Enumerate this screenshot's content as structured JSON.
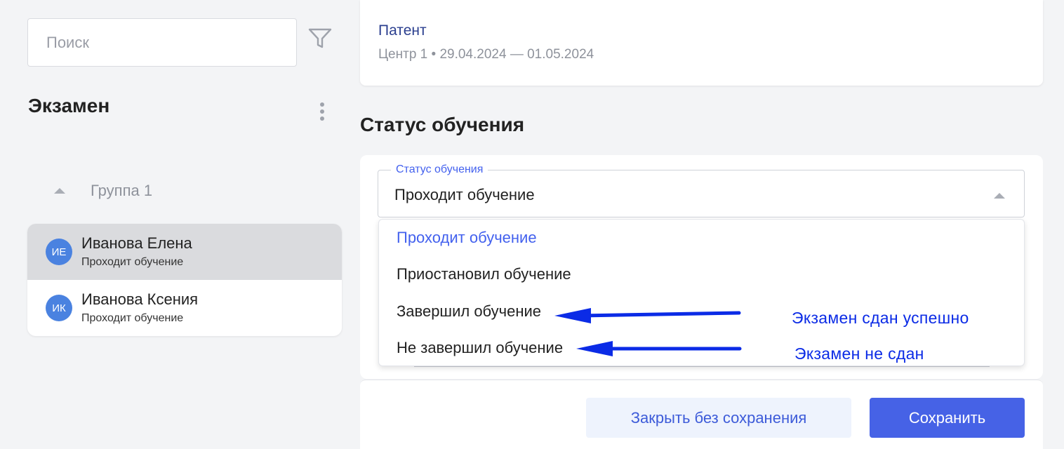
{
  "sidebar": {
    "search": {
      "placeholder": "Поиск",
      "value": ""
    },
    "filter_icon": "filter-funnel-icon",
    "title": "Экзамен",
    "group": {
      "label": "Группа 1",
      "expanded": true
    },
    "members": [
      {
        "initials": "ИЕ",
        "name": "Иванова Елена",
        "status": "Проходит обучение",
        "selected": true
      },
      {
        "initials": "ИК",
        "name": "Иванова Ксения",
        "status": "Проходит обучение",
        "selected": false
      }
    ]
  },
  "course": {
    "title": "Патент",
    "center": "Центр 1",
    "separator": "•",
    "dates": "29.04.2024 — 01.05.2024"
  },
  "status_section": {
    "heading": "Статус обучения",
    "field_label": "Статус обучения",
    "selected_value": "Проходит обучение",
    "options": [
      "Проходит обучение",
      "Приостановил обучение",
      "Завершил обучение",
      "Не завершил обучение"
    ]
  },
  "annotations": {
    "passed": "Экзамен сдан успешно",
    "failed": "Экзамен не сдан",
    "arrow_color": "#0b2be6"
  },
  "footer": {
    "close_label": "Закрыть без сохранения",
    "save_label": "Сохранить"
  },
  "colors": {
    "accent": "#4662e6",
    "avatar": "#4a82e0",
    "link": "#2b3f8f"
  }
}
